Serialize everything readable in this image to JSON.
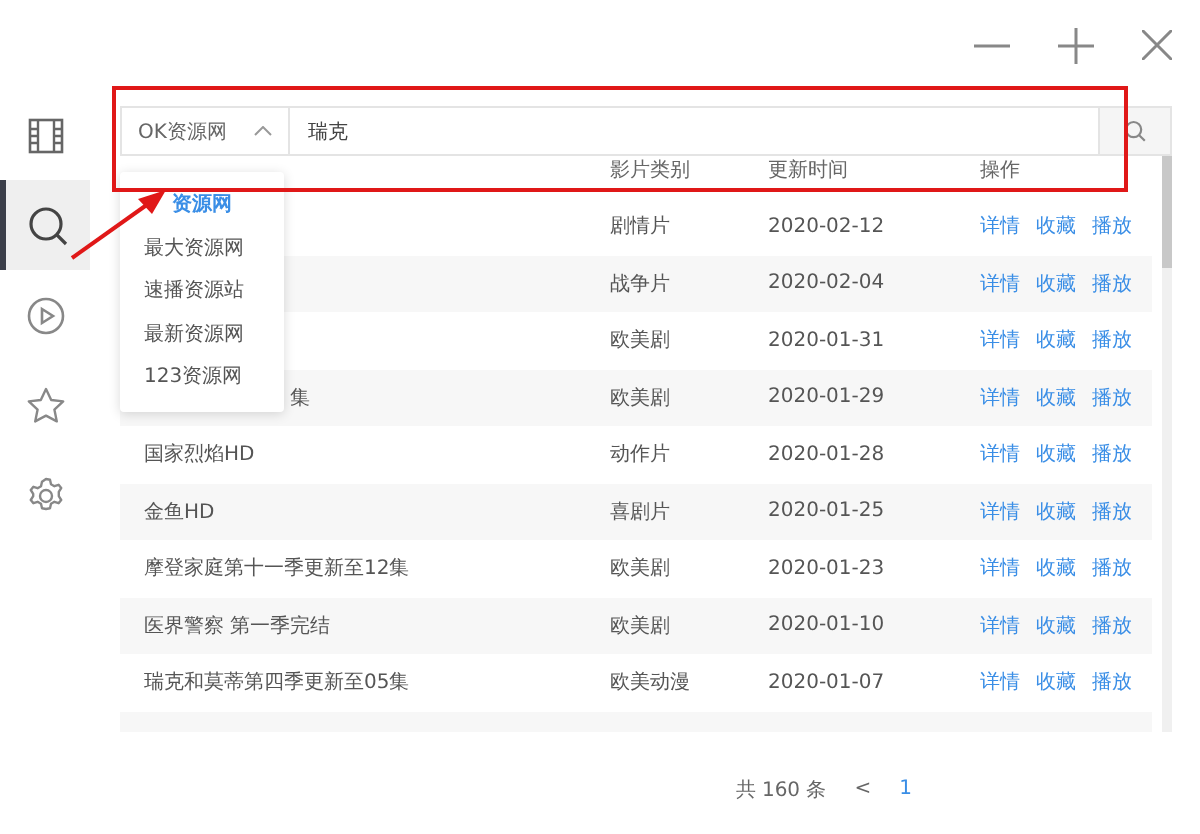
{
  "sidebar": {
    "items": [
      {
        "selected": false
      },
      {
        "selected": true
      },
      {
        "selected": false
      },
      {
        "selected": false
      },
      {
        "selected": false
      }
    ]
  },
  "search": {
    "source": "OK资源网",
    "value": "瑞克"
  },
  "source_menu": {
    "items": [
      {
        "label": "资源网",
        "selected": true
      },
      {
        "label": "最大资源网",
        "selected": false
      },
      {
        "label": "速播资源站",
        "selected": false
      },
      {
        "label": "最新资源网",
        "selected": false
      },
      {
        "label": "123资源网",
        "selected": false
      }
    ]
  },
  "table": {
    "columns": [
      "影片类别",
      "更新时间",
      "操作"
    ],
    "rows": [
      {
        "genre": "剧情片",
        "date": "2020-02-12",
        "actions": [
          "详情",
          "收藏",
          "播放"
        ]
      },
      {
        "genre": "战争片",
        "date": "2020-02-04",
        "actions": [
          "详情",
          "收藏",
          "播放"
        ]
      },
      {
        "genre": "欧美剧",
        "date": "2020-01-31",
        "actions": [
          "详情",
          "收藏",
          "播放"
        ]
      },
      {
        "name": "集",
        "kind": "covered",
        "genre": "欧美剧",
        "date": "2020-01-29",
        "actions": [
          "详情",
          "收藏",
          "播放"
        ]
      },
      {
        "name": "国家烈焰HD",
        "kind": "full",
        "genre": "动作片",
        "date": "2020-01-28",
        "actions": [
          "详情",
          "收藏",
          "播放"
        ]
      },
      {
        "name": "金鱼HD",
        "kind": "full",
        "genre": "喜剧片",
        "date": "2020-01-25",
        "actions": [
          "详情",
          "收藏",
          "播放"
        ]
      },
      {
        "name": "摩登家庭第十一季更新至12集",
        "kind": "full",
        "genre": "欧美剧",
        "date": "2020-01-23",
        "actions": [
          "详情",
          "收藏",
          "播放"
        ]
      },
      {
        "name": "医界警察 第一季完结",
        "kind": "full",
        "genre": "欧美剧",
        "date": "2020-01-10",
        "actions": [
          "详情",
          "收藏",
          "播放"
        ]
      },
      {
        "name": "瑞克和莫蒂第四季更新至05集",
        "kind": "full",
        "genre": "欧美动漫",
        "date": "2020-01-07",
        "actions": [
          "详情",
          "收藏",
          "播放"
        ]
      }
    ]
  },
  "pagination": {
    "total": "共 160 条",
    "prev": "<",
    "pages": [
      {
        "label": "1",
        "selected": true
      }
    ]
  }
}
